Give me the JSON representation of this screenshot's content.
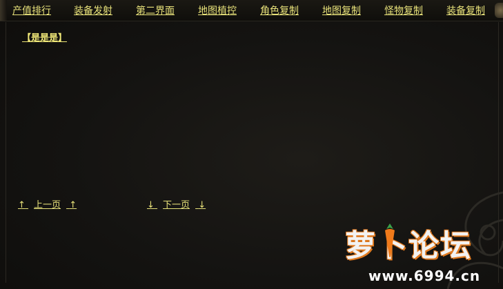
{
  "menu": {
    "items": [
      {
        "label": "产值排行"
      },
      {
        "label": "装备发射"
      },
      {
        "label": "第二界面"
      },
      {
        "label": "地图植控"
      },
      {
        "label": "角色复制"
      },
      {
        "label": "地图复制"
      },
      {
        "label": "怪物复制"
      },
      {
        "label": "装备复制"
      }
    ]
  },
  "content": {
    "section_title": "【是是是】"
  },
  "pager": {
    "prev_label": "上一页",
    "next_label": "下一页",
    "prev_arrow": "↑",
    "next_arrow": "↓"
  },
  "watermark": {
    "text": "萝卜论坛",
    "url": "www.6994.cn"
  },
  "colors": {
    "accent": "#e8e27a",
    "background": "#141311",
    "watermark_outline": "#e07a20"
  }
}
